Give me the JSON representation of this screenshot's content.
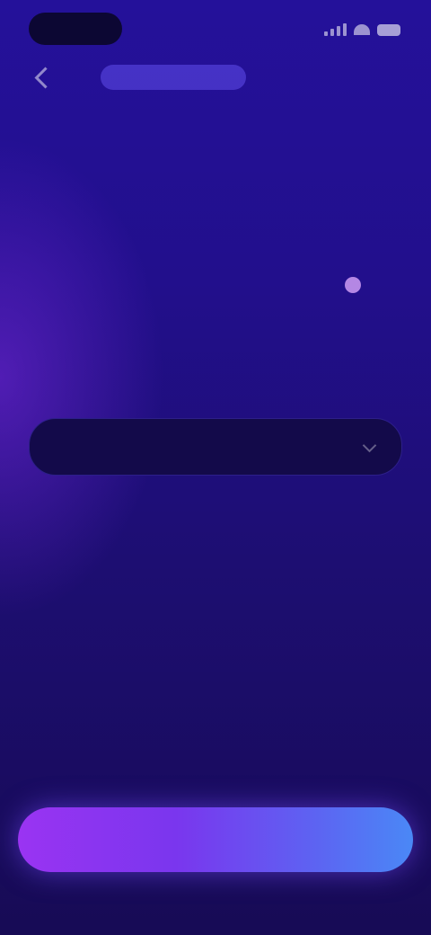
{
  "header": {
    "link_label": ""
  },
  "title": {
    "line1": "",
    "line2": ""
  },
  "rows": [
    {
      "label": "",
      "value": "",
      "secondary": ""
    },
    {
      "label": "",
      "value": "",
      "secondary": ""
    },
    {
      "label": "",
      "value": ""
    },
    {
      "label": "",
      "value": ""
    },
    {
      "label": "",
      "value": ""
    }
  ],
  "primary_button": {
    "label": ""
  },
  "icons": {
    "back": "chevron-left-icon",
    "coin": "coin-icon",
    "dropdown": "chevron-down-icon",
    "signal": "signal-icon",
    "wifi": "wifi-icon",
    "battery": "battery-icon"
  },
  "colors": {
    "background": "#1c0f6e",
    "button_start": "#9a34f2",
    "button_end": "#4a88f6",
    "accent_value": "#e8b7d6",
    "highlight_row": "#130a4a"
  }
}
